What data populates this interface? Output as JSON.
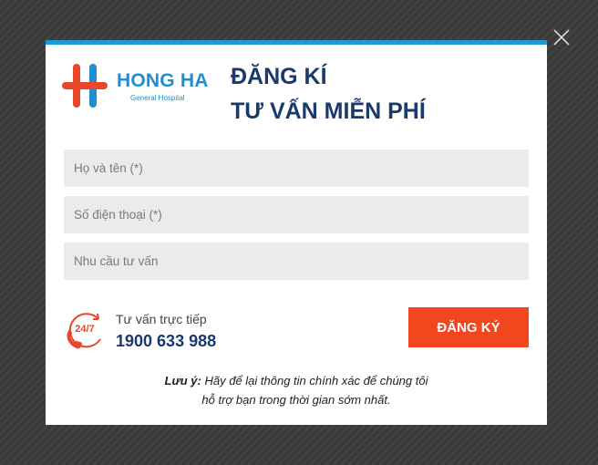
{
  "logo": {
    "name": "HONG HA",
    "subtitle": "General Hospital"
  },
  "title": {
    "line1": "ĐĂNG KÍ",
    "line2": "TƯ VẤN MIỄN PHÍ"
  },
  "form": {
    "name_placeholder": "Họ và tên (*)",
    "phone_placeholder": "Số điện thoại (*)",
    "need_placeholder": "Nhu cầu tư vấn",
    "submit_label": "ĐĂNG KÝ"
  },
  "hotline": {
    "icon_text": "24/7",
    "label": "Tư vấn trực tiếp",
    "number": "1900 633 988"
  },
  "note": {
    "prefix": "Lưu ý:",
    "line1": "Hãy để lại thông tin chính xác để chúng tôi",
    "line2": "hỗ trợ bạn trong thời gian sớm nhất."
  },
  "colors": {
    "accent_blue": "#1e9ad6",
    "brand_red": "#f2461f",
    "title_navy": "#1a3a6b"
  }
}
